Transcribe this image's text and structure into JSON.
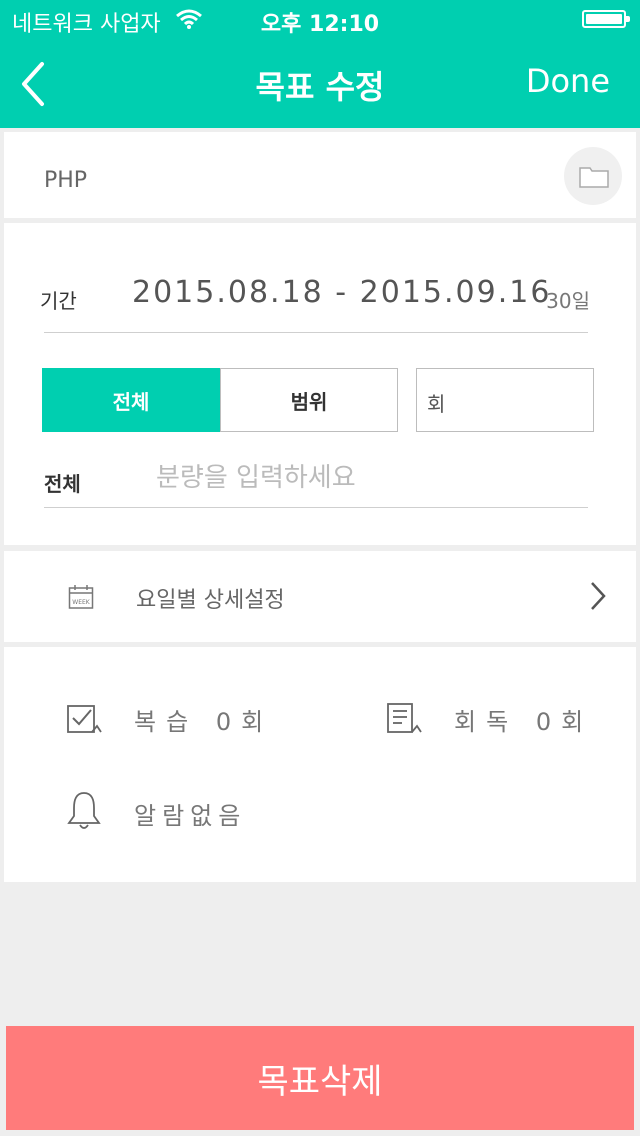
{
  "status_bar": {
    "carrier": "네트워크 사업자",
    "time": "오후 12:10"
  },
  "nav": {
    "title": "목표 수정",
    "done_label": "Done"
  },
  "goal": {
    "title": "PHP"
  },
  "period": {
    "label": "기간",
    "dates": "2015.08.18 - 2015.09.16",
    "days": "30일"
  },
  "segment": {
    "all_label": "전체",
    "range_label": "범위",
    "selected": "전체"
  },
  "unit_field": {
    "placeholder": "회"
  },
  "amount": {
    "label": "전체",
    "placeholder": "분량을 입력하세요"
  },
  "weekday": {
    "label": "요일별 상세설정",
    "icon_text": "WEEK"
  },
  "review": {
    "label": "복습",
    "count": "0",
    "unit": "회"
  },
  "reread": {
    "label": "회독",
    "count": "0",
    "unit": "회"
  },
  "alarm": {
    "label": "알람없음"
  },
  "delete_label": "목표삭제",
  "colors": {
    "accent": "#00cfb0",
    "danger": "#ff7b7b",
    "background": "#eeeeee"
  }
}
